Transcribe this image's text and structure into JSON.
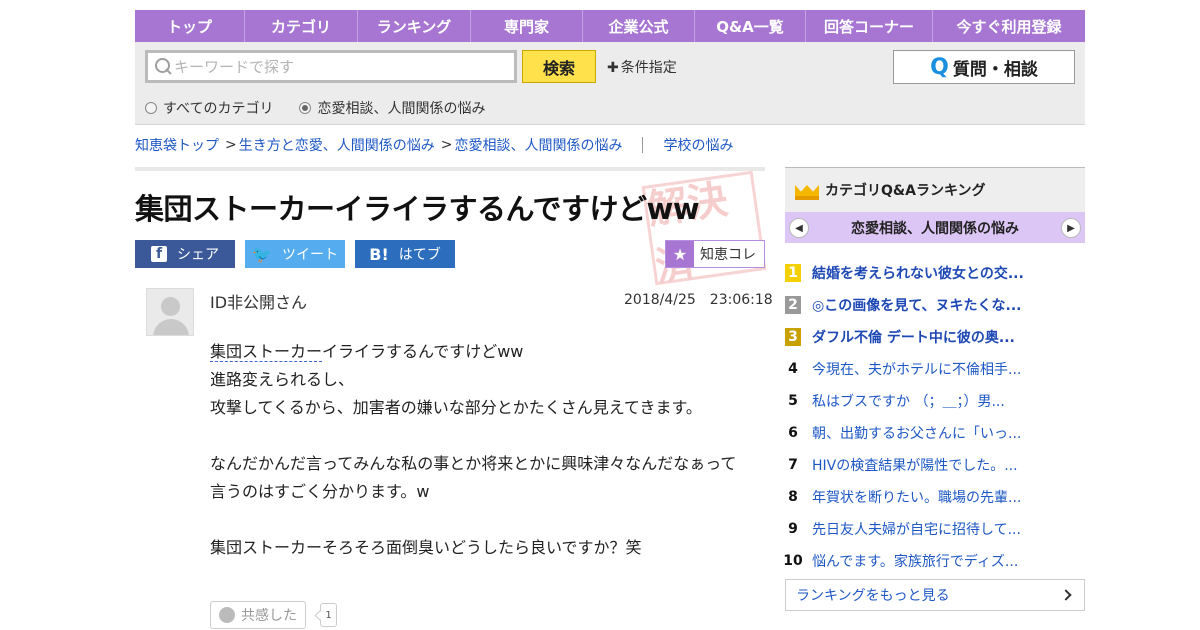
{
  "gnav": [
    "トップ",
    "カテゴリ",
    "ランキング",
    "専門家",
    "企業公式",
    "Q&A一覧",
    "回答コーナー",
    "今すぐ利用登録"
  ],
  "search": {
    "placeholder": "キーワードで探す",
    "button": "検索",
    "condition": "条件指定",
    "ask_button": "質問・相談",
    "radio_all": "すべてのカテゴリ",
    "radio_cat": "恋愛相談、人間関係の悩み"
  },
  "breadcrumb": {
    "top": "知恵袋トップ",
    "c1": "生き方と恋愛、人間関係の悩み",
    "c2": "恋愛相談、人間関係の悩み",
    "c3": "学校の悩み"
  },
  "question": {
    "title": "集団ストーカーイライラするんですけどww",
    "stamp": "解決済",
    "share_fb": "シェア",
    "share_tw": "ツイート",
    "share_hb": "はてブ",
    "chiekore": "知恵コレ",
    "user": "ID非公開さん",
    "date": "2018/4/25　23:06:18",
    "body_kw": "集団ストーカー",
    "body_l1_rest": "イライラするんですけどww",
    "body_l2": "進路変えられるし、",
    "body_l3": "攻撃してくるから、加害者の嫌いな部分とかたくさん見えてきます。",
    "body_l5": "なんだかんだ言ってみんな私の事とか将来とかに興味津々なんだなぁって",
    "body_l6": "言うのはすごく分かります。w",
    "body_l8": "集団ストーカーそろそろ面倒臭いどうしたら良いですか？笑",
    "kyokan": "共感した",
    "kyokan_count": "1"
  },
  "ranking": {
    "title": "カテゴリQ&Aランキング",
    "category": "恋愛相談、人間関係の悩み",
    "items": [
      {
        "n": "1",
        "t": "結婚を考えられない彼女との交..."
      },
      {
        "n": "2",
        "t": "◎この画像を見て、ヌキたくな..."
      },
      {
        "n": "3",
        "t": "ダフル不倫 デート中に彼の奥..."
      },
      {
        "n": "4",
        "t": "今現在、夫がホテルに不倫相手..."
      },
      {
        "n": "5",
        "t": "私はブスですか （；＿；）男..."
      },
      {
        "n": "6",
        "t": "朝、出勤するお父さんに「いっ..."
      },
      {
        "n": "7",
        "t": "HIVの検査結果が陽性でした。..."
      },
      {
        "n": "8",
        "t": "年賀状を断りたい。職場の先輩..."
      },
      {
        "n": "9",
        "t": "先日友人夫婦が自宅に招待して..."
      },
      {
        "n": "10",
        "t": "悩んでます。家族旅行でディズ..."
      }
    ],
    "more": "ランキングをもっと見る"
  }
}
